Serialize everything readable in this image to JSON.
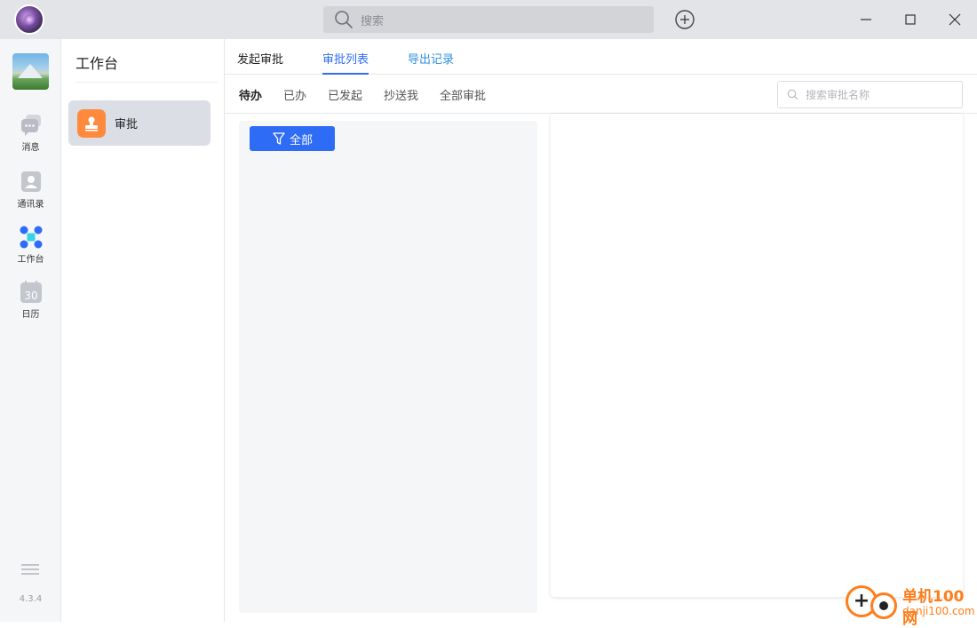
{
  "titlebar": {
    "search_placeholder": "搜索"
  },
  "rail": {
    "items": [
      {
        "label": "消息",
        "icon": "chat-icon"
      },
      {
        "label": "通讯录",
        "icon": "contacts-icon"
      },
      {
        "label": "工作台",
        "icon": "workbench-icon"
      },
      {
        "label": "日历",
        "icon": "calendar-icon",
        "day": "30"
      }
    ],
    "version": "4.3.4"
  },
  "side2": {
    "title": "工作台",
    "items": [
      {
        "label": "审批",
        "icon": "stamp-icon"
      }
    ]
  },
  "main": {
    "tabs": [
      {
        "label": "发起审批"
      },
      {
        "label": "审批列表"
      },
      {
        "label": "导出记录"
      }
    ],
    "subtabs": [
      {
        "label": "待办"
      },
      {
        "label": "已办"
      },
      {
        "label": "已发起"
      },
      {
        "label": "抄送我"
      },
      {
        "label": "全部审批"
      }
    ],
    "search_placeholder": "搜索审批名称",
    "filter_label": "全部"
  },
  "watermark": {
    "line1": "单机100网",
    "line2": "danji100.com"
  },
  "colors": {
    "accent": "#2f6cf6",
    "approval_icon": "#ff8a3d"
  }
}
